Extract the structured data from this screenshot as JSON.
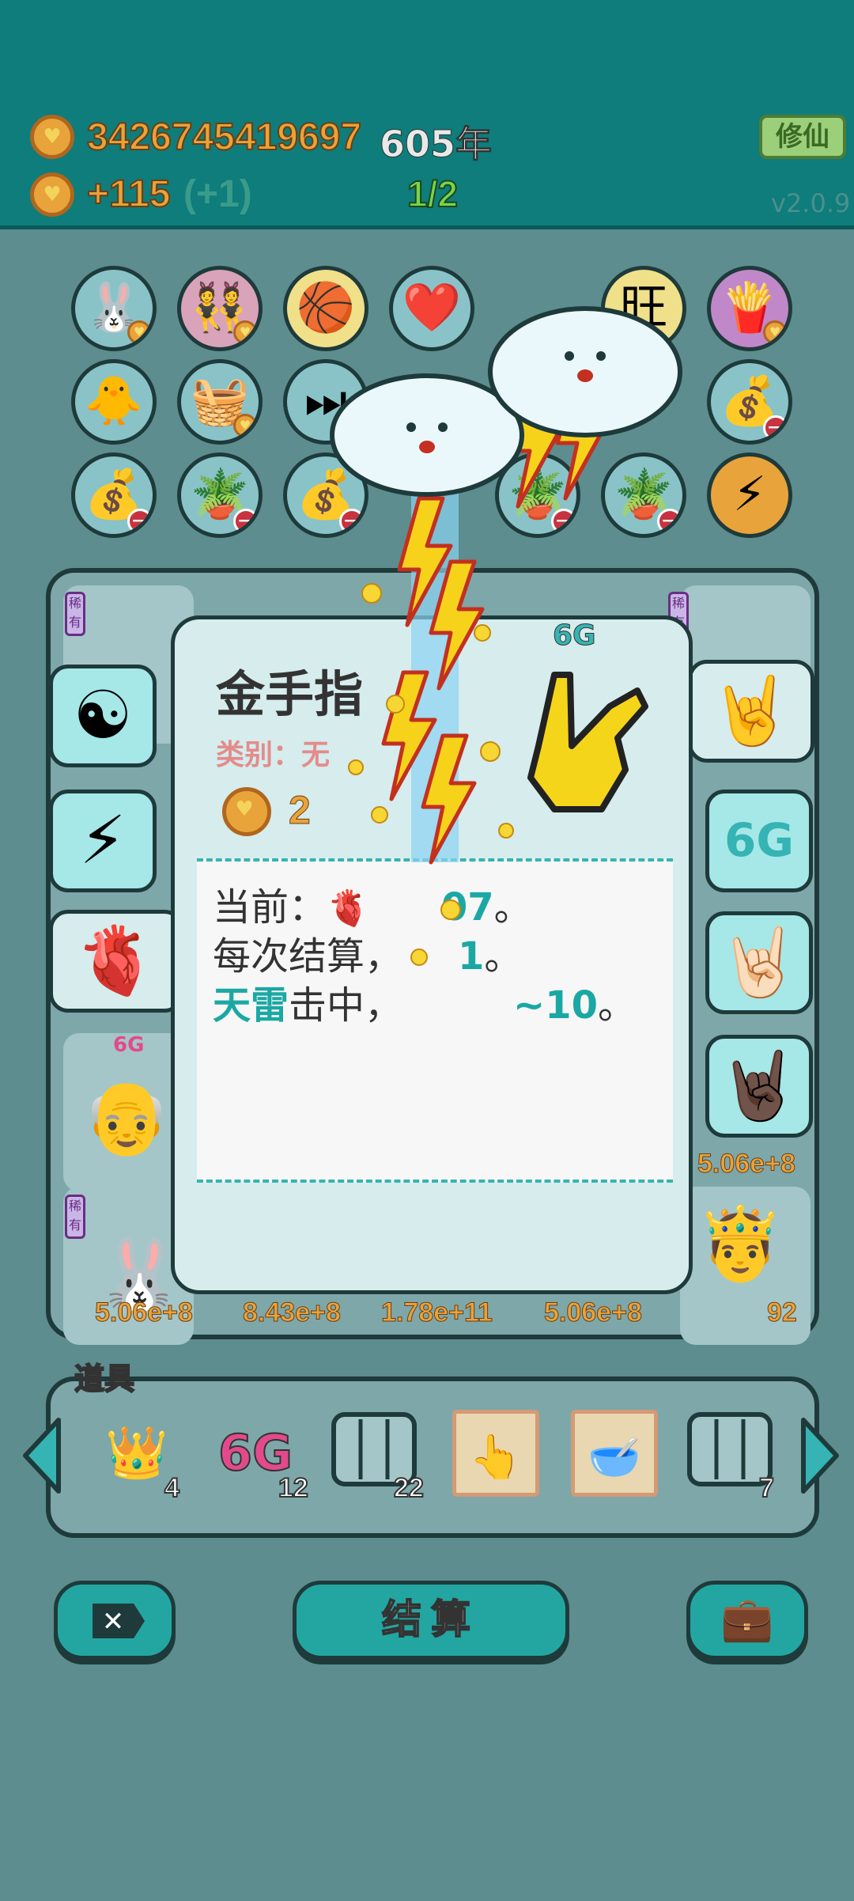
{
  "header": {
    "coins": "3426745419697",
    "years": "605年",
    "income": "+115",
    "income_bonus": "(+1)",
    "progress": "1/2",
    "cultivate_button": "修仙",
    "version": "v2.0.9"
  },
  "popup": {
    "title": "金手指",
    "category": "类别：无",
    "cost": "2",
    "lines": {
      "current_label": "当前：",
      "current_value": "07",
      "current_end": "。",
      "settle_label": "每次结算，",
      "settle_value": "1",
      "settle_end": "。",
      "thunder_label": "天雷",
      "thunder_text": "击中，",
      "thunder_value": "~10",
      "thunder_end": "。"
    },
    "badge_6g": "6G"
  },
  "board": {
    "values": [
      "5.06e+8",
      "8.43e+8",
      "1.78e+11",
      "5.06e+8",
      "92"
    ],
    "right_value": "5.06e+8",
    "tag_rare": "稀有",
    "badge_6g": "6G"
  },
  "tools": {
    "label": "道具",
    "items": [
      {
        "icon": "crown-icon",
        "count": "4"
      },
      {
        "icon": "6g-icon",
        "count": "12"
      },
      {
        "icon": "frame-icon",
        "count": "22"
      },
      {
        "icon": "finger-card-icon",
        "count": ""
      },
      {
        "icon": "bowl-card-icon",
        "count": ""
      },
      {
        "icon": "rare-frame-icon",
        "count": "7"
      }
    ],
    "label_6g": "6G"
  },
  "bottom": {
    "settle_button": "结算"
  },
  "colors": {
    "header": "#0e7d7b",
    "gold": "#e8a33a",
    "accent": "#23a6a1",
    "highlight": "#1ba8a4"
  }
}
